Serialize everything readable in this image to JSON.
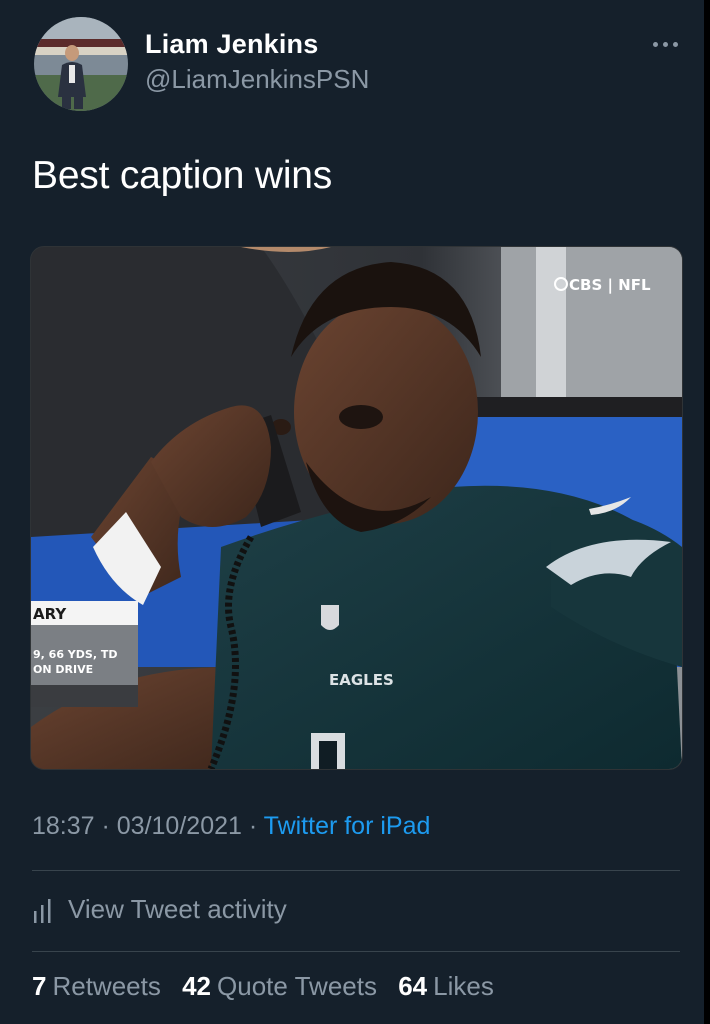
{
  "tweet": {
    "author": {
      "display_name": "Liam Jenkins",
      "handle": "@LiamJenkinsPSN"
    },
    "text": "Best caption wins",
    "media": {
      "broadcast_logo": "CBS | NFL",
      "lower_third_top": "ARY",
      "lower_third_line1": "9, 66 YDS, TD",
      "lower_third_line2": "ON DRIVE",
      "chest_text": "EAGLES"
    },
    "timestamp": "18:37 · 03/10/2021 · ",
    "source": "Twitter for iPad",
    "activity_label": "View Tweet activity",
    "stats": [
      {
        "count": "7",
        "label": "Retweets"
      },
      {
        "count": "42",
        "label": "Quote Tweets"
      },
      {
        "count": "64",
        "label": "Likes"
      }
    ]
  },
  "icons": {
    "more": "more-icon",
    "activity": "bar-chart-icon"
  },
  "colors": {
    "background": "#15202b",
    "secondary_text": "#8b98a5",
    "link": "#1d9bf0",
    "divider": "#38444d"
  }
}
